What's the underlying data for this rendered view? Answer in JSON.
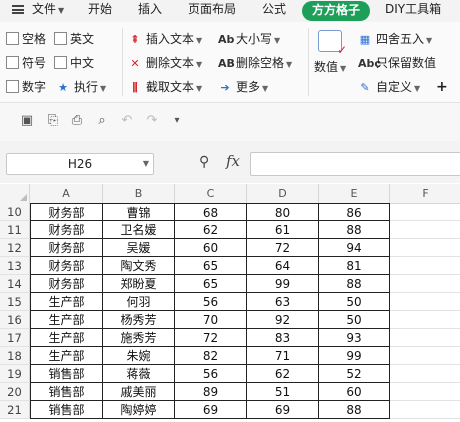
{
  "menu": {
    "file": "文件",
    "tabs": [
      "开始",
      "插入",
      "页面布局",
      "公式",
      "方方格子",
      "DIY工具箱"
    ],
    "active_tab": "方方格子",
    "accent": "#1e9f59"
  },
  "ribbon": {
    "checks": [
      "空格",
      "英文",
      "符号",
      "中文",
      "数字"
    ],
    "execute": "执行",
    "text_tools": [
      "插入文本",
      "删除文本",
      "截取文本"
    ],
    "case_tools": [
      "大小写",
      "删除空格",
      "更多"
    ],
    "value_label": "数值",
    "rounding": "四舍五入",
    "keep_value": "只保留数值",
    "custom": "自定义",
    "plus": "+"
  },
  "quick_access": {
    "icons": [
      "save-icon",
      "pdf-icon",
      "print-icon",
      "print-preview-icon",
      "undo-icon",
      "redo-icon",
      "more-icon"
    ]
  },
  "formula_bar": {
    "cell_ref": "H26",
    "fx": "fx",
    "formula": ""
  },
  "grid": {
    "columns": [
      "A",
      "B",
      "C",
      "D",
      "E",
      "F"
    ],
    "rows": [
      {
        "num": "10",
        "cells": [
          "财务部",
          "曹锦",
          "68",
          "80",
          "86"
        ]
      },
      {
        "num": "11",
        "cells": [
          "财务部",
          "卫名媛",
          "62",
          "61",
          "88"
        ]
      },
      {
        "num": "12",
        "cells": [
          "财务部",
          "吴媛",
          "60",
          "72",
          "94"
        ]
      },
      {
        "num": "13",
        "cells": [
          "财务部",
          "陶文秀",
          "65",
          "64",
          "81"
        ]
      },
      {
        "num": "14",
        "cells": [
          "财务部",
          "郑盼夏",
          "65",
          "99",
          "88"
        ]
      },
      {
        "num": "15",
        "cells": [
          "生产部",
          "何羽",
          "56",
          "63",
          "50"
        ]
      },
      {
        "num": "16",
        "cells": [
          "生产部",
          "杨秀芳",
          "70",
          "92",
          "50"
        ]
      },
      {
        "num": "17",
        "cells": [
          "生产部",
          "施秀芳",
          "72",
          "83",
          "93"
        ]
      },
      {
        "num": "18",
        "cells": [
          "生产部",
          "朱婉",
          "82",
          "71",
          "99"
        ]
      },
      {
        "num": "19",
        "cells": [
          "销售部",
          "蒋薇",
          "56",
          "62",
          "52"
        ]
      },
      {
        "num": "20",
        "cells": [
          "销售部",
          "戚美丽",
          "89",
          "51",
          "60"
        ]
      },
      {
        "num": "21",
        "cells": [
          "销售部",
          "陶婷婷",
          "69",
          "69",
          "88"
        ]
      }
    ]
  }
}
